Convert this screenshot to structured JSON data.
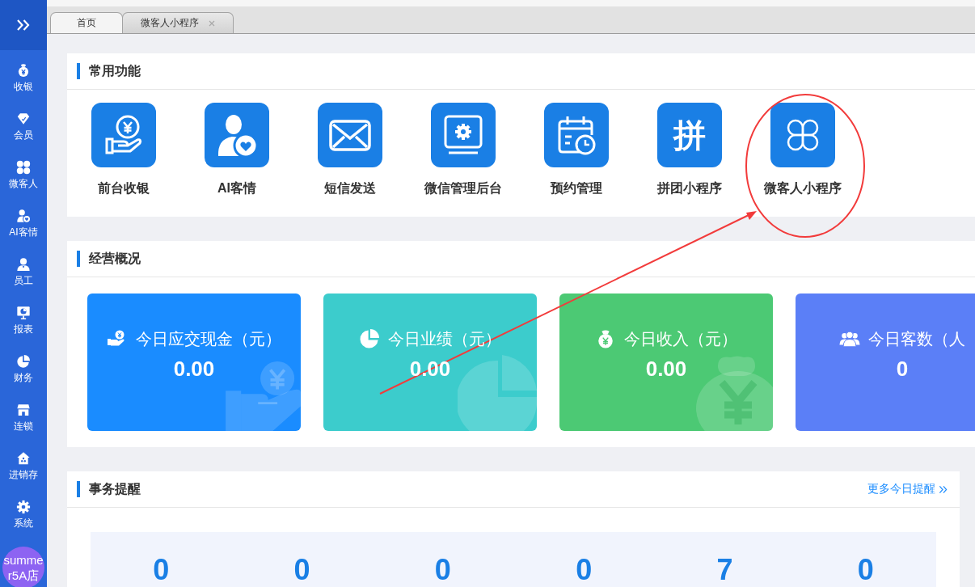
{
  "sidebar": {
    "items": [
      {
        "kind": "cashier",
        "label": "收银"
      },
      {
        "kind": "member",
        "label": "会员"
      },
      {
        "kind": "clover",
        "label": "微客人"
      },
      {
        "kind": "ai",
        "label": "AI客情"
      },
      {
        "kind": "staff",
        "label": "员工"
      },
      {
        "kind": "report",
        "label": "报表"
      },
      {
        "kind": "finance",
        "label": "财务"
      },
      {
        "kind": "chain",
        "label": "连锁"
      },
      {
        "kind": "inventory",
        "label": "进销存"
      },
      {
        "kind": "system",
        "label": "系统"
      }
    ],
    "store_badge": "summer5A店"
  },
  "tabs": [
    {
      "label": "首页",
      "selected": true,
      "closable": false
    },
    {
      "label": "微客人小程序",
      "selected": false,
      "closable": true
    }
  ],
  "shortcuts": {
    "title": "常用功能",
    "items": [
      {
        "kind": "cashier",
        "label": "前台收银"
      },
      {
        "kind": "ai",
        "label": "AI客情"
      },
      {
        "kind": "sms",
        "label": "短信发送"
      },
      {
        "kind": "wechat",
        "label": "微信管理后台"
      },
      {
        "kind": "booking",
        "label": "预约管理"
      },
      {
        "kind": "glyph",
        "glyph": "拼",
        "label": "拼团小程序"
      },
      {
        "kind": "clover",
        "label": "微客人小程序"
      }
    ]
  },
  "overview": {
    "title": "经营概况",
    "cards": [
      {
        "kind": "cash",
        "title": "今日应交现金（元）",
        "value": "0.00"
      },
      {
        "kind": "sales",
        "title": "今日业绩（元）",
        "value": "0.00"
      },
      {
        "kind": "income",
        "title": "今日收入（元）",
        "value": "0.00"
      },
      {
        "kind": "customers",
        "title": "今日客数（人",
        "value": "0"
      }
    ]
  },
  "reminders": {
    "title": "事务提醒",
    "more_link": "更多今日提醒",
    "counts": [
      "0",
      "0",
      "0",
      "0",
      "7",
      "0"
    ]
  }
}
